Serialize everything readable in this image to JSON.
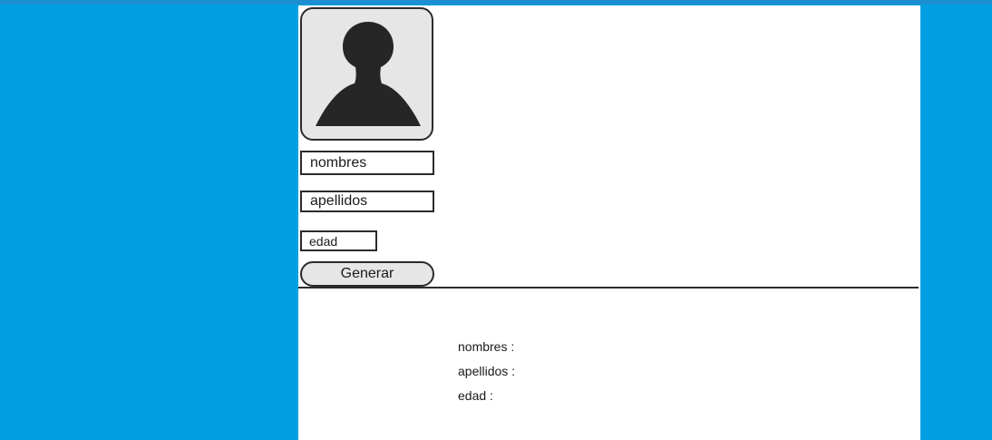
{
  "colors": {
    "background": "#00a0e3",
    "panel": "#ffffff",
    "border": "#2b2b2b",
    "avatar_fill": "#e6e6e6",
    "avatar_silhouette": "#262626"
  },
  "avatar": {
    "icon": "user-silhouette-icon"
  },
  "form": {
    "nombres_placeholder": "nombres",
    "apellidos_placeholder": "apellidos",
    "edad_placeholder": "edad",
    "generate_label": "Generar"
  },
  "output": {
    "nombres_label": "nombres :",
    "apellidos_label": "apellidos :",
    "edad_label": "edad :"
  }
}
